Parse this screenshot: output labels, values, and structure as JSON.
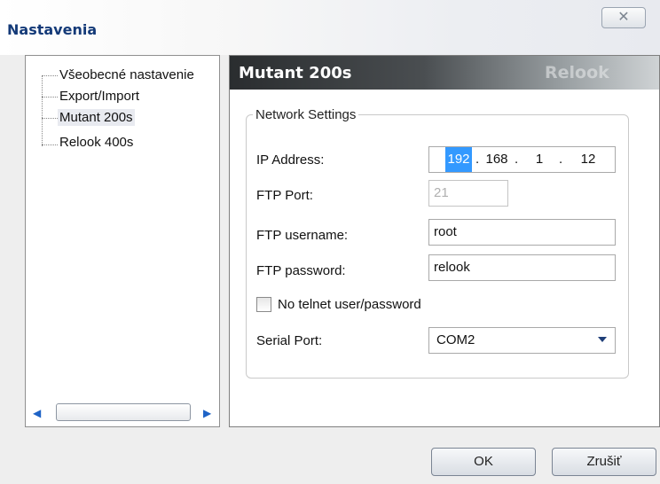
{
  "window": {
    "title": "Nastavenia",
    "close_glyph": "✕"
  },
  "tree": {
    "items": [
      {
        "label": "Všeobecné nastavenie"
      },
      {
        "label": "Export/Import"
      },
      {
        "label": "Mutant 200s",
        "selected": true
      },
      {
        "label": "Relook 400s"
      }
    ],
    "scroll_left_glyph": "◀",
    "scroll_right_glyph": "▶"
  },
  "panel": {
    "title": "Mutant 200s",
    "brand": "Relook",
    "group_title": "Network Settings",
    "ip_address": {
      "label": "IP Address:",
      "octets": [
        "192",
        "168",
        "1",
        "12"
      ],
      "dot": "."
    },
    "ftp_port": {
      "label": "FTP Port:",
      "value": "21"
    },
    "ftp_username": {
      "label": "FTP username:",
      "value": "root"
    },
    "ftp_password": {
      "label": "FTP password:",
      "value": "relook"
    },
    "telnet_checkbox": {
      "label": "No telnet user/password",
      "checked": false
    },
    "serial_port": {
      "label": "Serial Port:",
      "value": "COM2"
    }
  },
  "buttons": {
    "ok": "OK",
    "cancel": "Zrušiť"
  }
}
